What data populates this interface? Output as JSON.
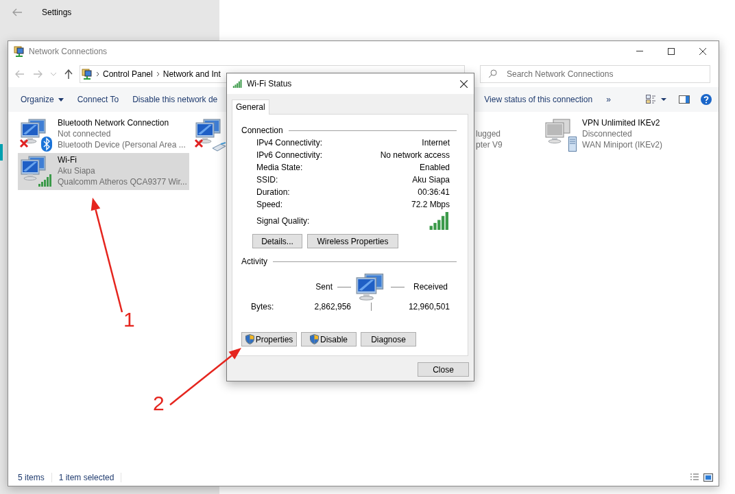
{
  "settings": {
    "title": "Settings"
  },
  "window": {
    "title": "Network Connections",
    "breadcrumb": [
      "Control Panel",
      "Network and Int"
    ],
    "search": {
      "placeholder": "Search Network Connections"
    },
    "toolbar": [
      {
        "label": "Organize",
        "kind": "menu"
      },
      {
        "label": "Connect To",
        "kind": "plain"
      },
      {
        "label": "Disable this network de",
        "kind": "plain"
      },
      {
        "label": "View status of this connection",
        "kind": "plain"
      },
      {
        "label": "»",
        "kind": "more"
      }
    ],
    "connections": [
      {
        "kind": "bluetooth",
        "failed": true,
        "selected": false,
        "name": "Bluetooth Network Connection",
        "status": "Not connected",
        "device": "Bluetooth Device (Personal Area ..."
      },
      {
        "kind": "ethernet",
        "failed": true,
        "selected": false
      },
      {
        "kind": "partial",
        "failed": false,
        "selected": false,
        "status": "lugged",
        "device": "pter V9"
      },
      {
        "kind": "vpn",
        "failed": false,
        "selected": false,
        "name": "VPN Unlimited IKEv2",
        "status": "Disconnected",
        "device": "WAN Miniport (IKEv2)"
      },
      {
        "kind": "wifi",
        "failed": false,
        "selected": true,
        "name": "Wi-Fi",
        "status": "Aku Siapa",
        "device": "Qualcomm Atheros QCA9377 Wir..."
      }
    ],
    "status_bar": [
      "5 items",
      "1 item selected"
    ]
  },
  "dialog": {
    "title": "Wi-Fi Status",
    "tabs": [
      {
        "label": "General",
        "selected": true
      }
    ],
    "connection_heading": "Connection",
    "fields": [
      {
        "label": "IPv4 Connectivity:",
        "value": "Internet"
      },
      {
        "label": "IPv6 Connectivity:",
        "value": "No network access"
      },
      {
        "label": "Media State:",
        "value": "Enabled"
      },
      {
        "label": "SSID:",
        "value": "Aku Siapa"
      },
      {
        "label": "Duration:",
        "value": "00:36:41"
      },
      {
        "label": "Speed:",
        "value": "72.2 Mbps"
      }
    ],
    "signal_label": "Signal Quality:",
    "connection_buttons": [
      "Details...",
      "Wireless Properties"
    ],
    "activity_heading": "Activity",
    "sent_label": "Sent",
    "received_label": "Received",
    "bytes_label": "Bytes:",
    "bytes_sent": "2,862,956",
    "bytes_received": "12,960,501",
    "actions": [
      {
        "label": "Properties",
        "shield": true
      },
      {
        "label": "Disable",
        "shield": true
      },
      {
        "label": "Diagnose",
        "shield": false
      }
    ],
    "close": "Close"
  },
  "annotations": [
    {
      "label": "1"
    },
    {
      "label": "2"
    }
  ]
}
